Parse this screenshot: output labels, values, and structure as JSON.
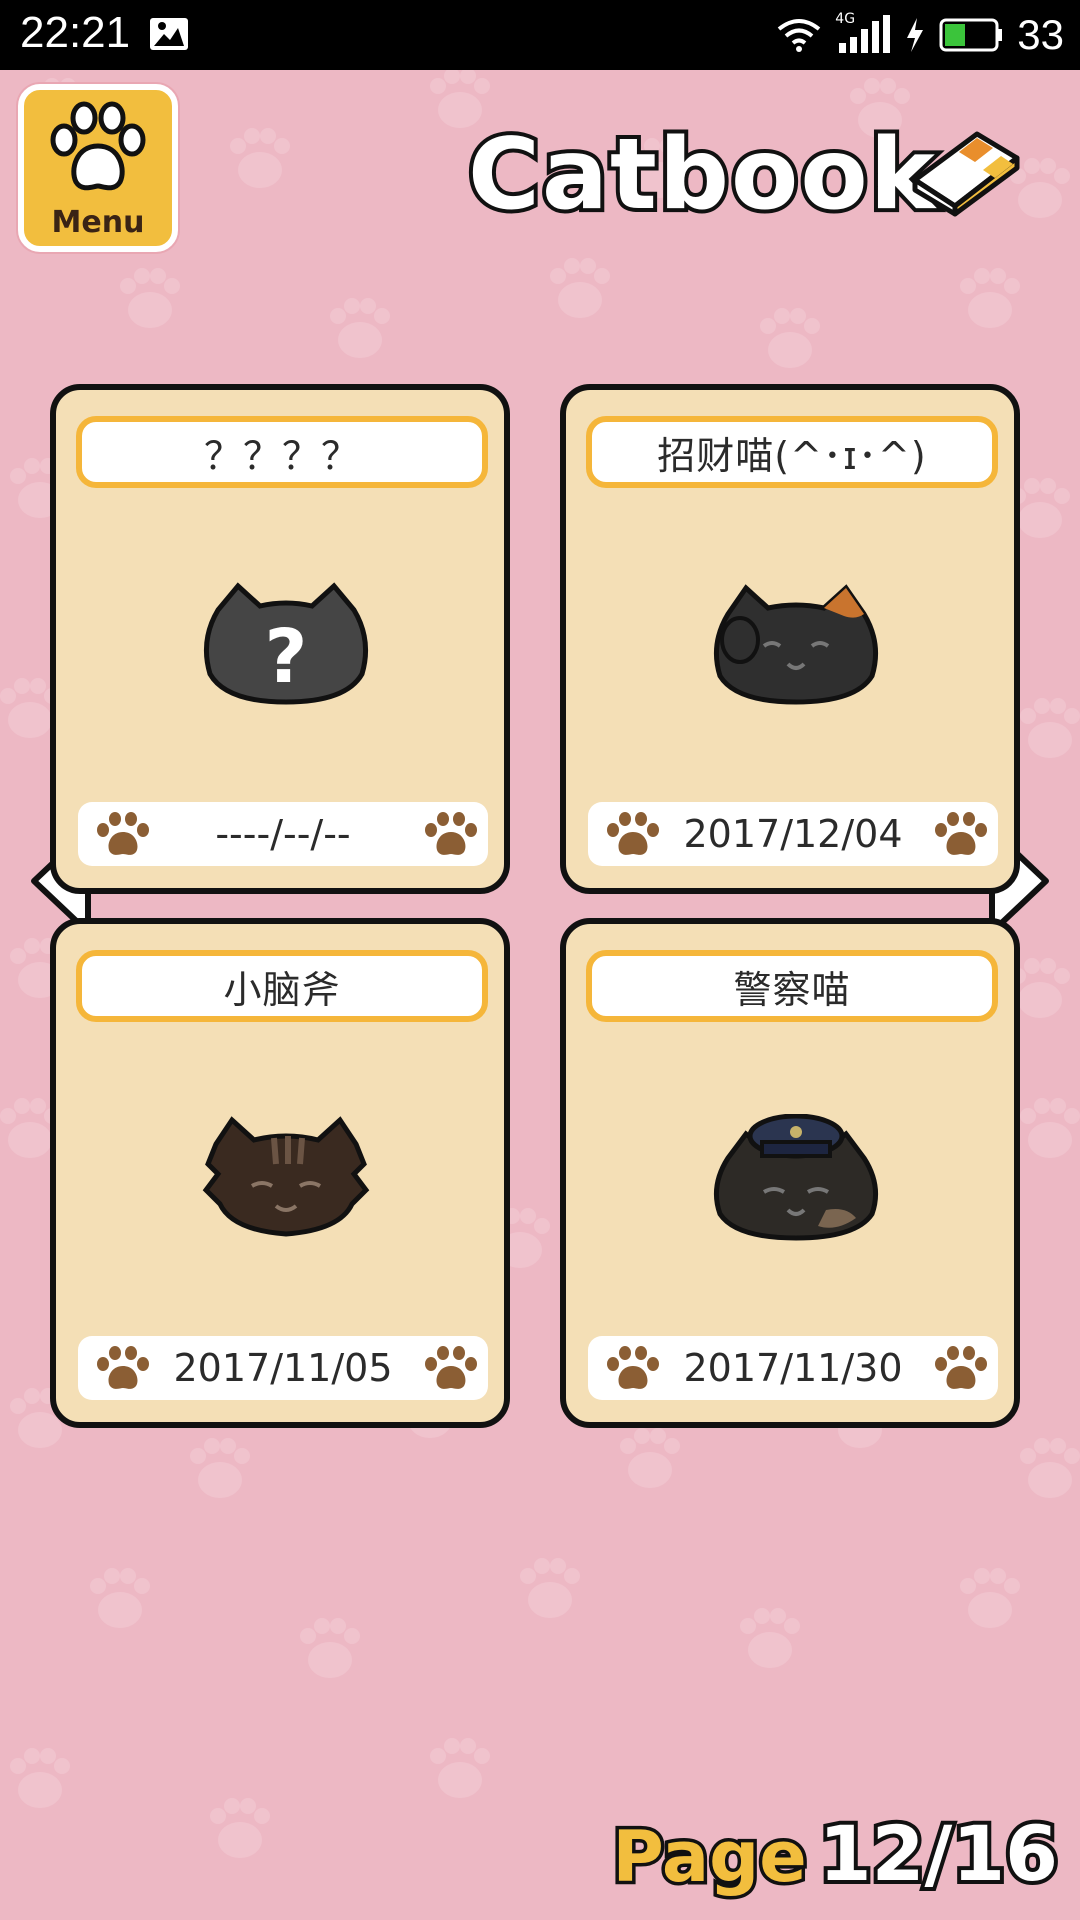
{
  "status_bar": {
    "time": "22:21",
    "network": "4G",
    "battery_level": "33",
    "icons": [
      "image-icon",
      "wifi-icon",
      "signal-icon",
      "charging-icon",
      "battery-icon"
    ]
  },
  "menu": {
    "label": "Menu",
    "icon": "paw-icon",
    "color": "#F2BE3E"
  },
  "header": {
    "title": "Catbook",
    "icon": "book-icon"
  },
  "cards": [
    {
      "name": "？？？？",
      "date": "----/--/--",
      "face": "unknown-cat-icon"
    },
    {
      "name": "招财喵(^･ɪ･^)",
      "date": "2017/12/04",
      "face": "lucky-cat-icon"
    },
    {
      "name": "小脑斧",
      "date": "2017/11/05",
      "face": "tabby-cat-icon"
    },
    {
      "name": "警察喵",
      "date": "2017/11/30",
      "face": "police-cat-icon"
    }
  ],
  "pagination": {
    "label": "Page",
    "current": "12/16"
  },
  "colors": {
    "background": "#EDB8C4",
    "card": "#F4DFB6",
    "name_border": "#F5B63A",
    "paw": "#8B5E34"
  }
}
